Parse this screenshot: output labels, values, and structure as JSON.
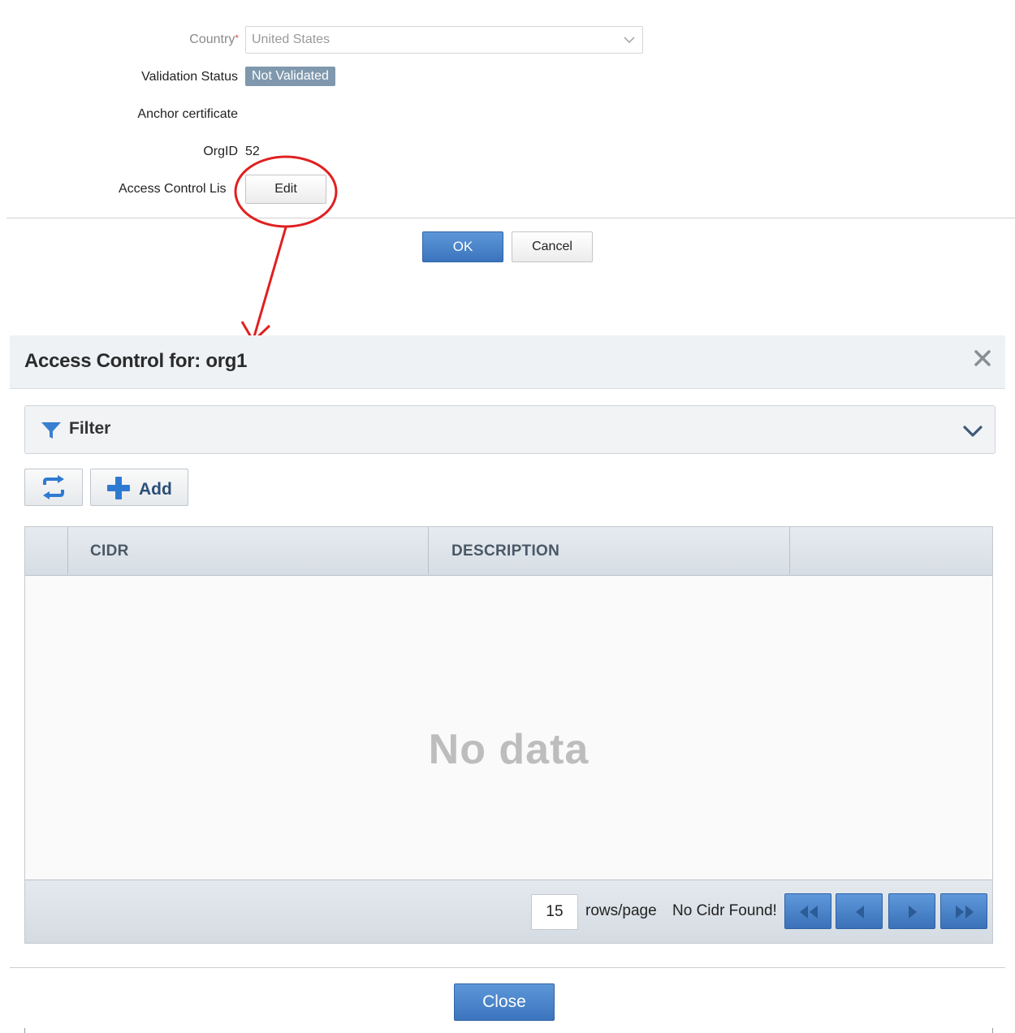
{
  "form": {
    "country_label": "Country",
    "country_required_mark": "*",
    "country_value": "United States",
    "validation_label": "Validation Status",
    "validation_value": "Not Validated",
    "anchor_label": "Anchor certificate",
    "orgid_label": "OrgID",
    "orgid_value": "52",
    "acl_label": "Access Control Lis",
    "edit_label": "Edit",
    "ok_label": "OK",
    "cancel_label": "Cancel"
  },
  "annotation": {
    "color": "#e02020"
  },
  "dialog": {
    "title": "Access Control for: org1",
    "filter_label": "Filter",
    "add_label": "Add",
    "columns": [
      "CIDR",
      "DESCRIPTION",
      ""
    ],
    "empty_text": "No data",
    "rows_per_page": "15",
    "rows_page_label": "rows/page",
    "status_text": "No Cidr Found!",
    "close_label": "Close"
  },
  "colors": {
    "accent_blue": "#3b74bd",
    "badge": "#7f98ad"
  }
}
